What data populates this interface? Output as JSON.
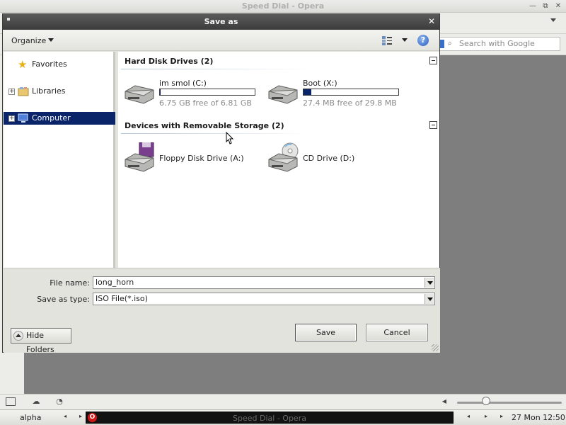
{
  "opera": {
    "window_title": "Speed Dial - Opera",
    "search_placeholder": "Search with Google",
    "minimize_glyph": "—",
    "restore_glyph": "⧉",
    "close_glyph": "✕"
  },
  "dialog": {
    "title": "Save as",
    "close_glyph": "✕",
    "toolbar": {
      "organize_label": "Organize",
      "help_glyph": "?"
    },
    "nav": {
      "favorites": "Favorites",
      "libraries": "Libraries",
      "computer": "Computer"
    },
    "groups": {
      "hard_disk": {
        "header": "Hard Disk Drives (2)",
        "drives": [
          {
            "name": "im smol (C:)",
            "free": "6.75 GB free of 6.81 GB",
            "used_fraction": 0.01
          },
          {
            "name": "Boot (X:)",
            "free": "27.4 MB free of 29.8 MB",
            "used_fraction": 0.08
          }
        ]
      },
      "removable": {
        "header": "Devices with Removable Storage (2)",
        "devices": [
          {
            "name": "Floppy Disk Drive (A:)",
            "icon": "floppy-drive-icon"
          },
          {
            "name": "CD Drive (D:)",
            "icon": "cd-drive-icon"
          }
        ]
      }
    },
    "file_name_label": "File name:",
    "file_name_value": "long_horn",
    "save_type_label": "Save as type:",
    "save_type_value": "ISO File(*.iso)",
    "hide_folders_label": "Hide Folders",
    "save_label": "Save",
    "cancel_label": "Cancel"
  },
  "taskbar": {
    "workspace": "alpha",
    "task_title": "Speed Dial - Opera",
    "opera_glyph": "O",
    "clock": "27 Mon 12:50"
  },
  "colors": {
    "selection": "#0a246a",
    "dialog_title": "#3c3c3c",
    "opera_red": "#d01818"
  }
}
